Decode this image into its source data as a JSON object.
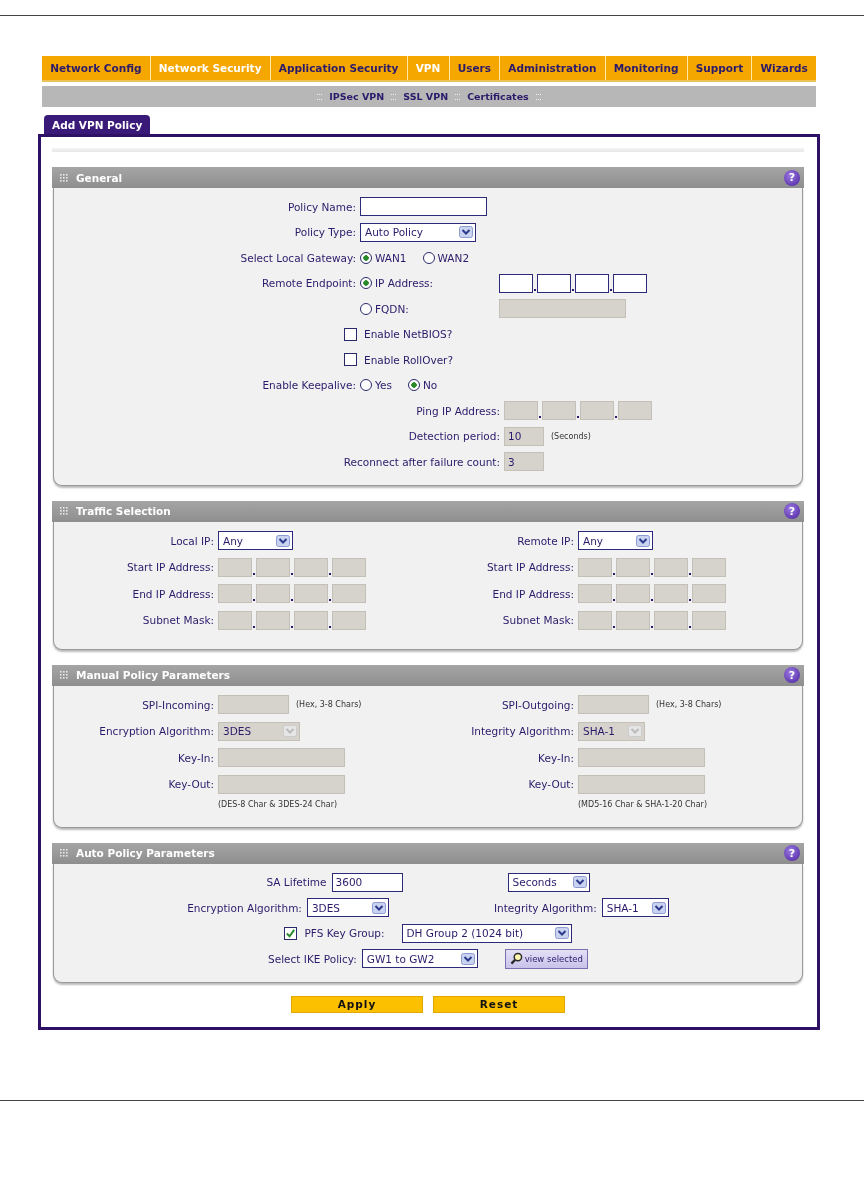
{
  "nav": [
    {
      "label": "Network Config",
      "selected": false
    },
    {
      "label": "Network Security",
      "selected": true
    },
    {
      "label": "Application Security",
      "selected": false
    },
    {
      "label": "VPN",
      "selected": true
    },
    {
      "label": "Users",
      "selected": false
    },
    {
      "label": "Administration",
      "selected": false
    },
    {
      "label": "Monitoring",
      "selected": false
    },
    {
      "label": "Support",
      "selected": false
    },
    {
      "label": "Wizards",
      "selected": false
    }
  ],
  "subnav": [
    {
      "label": "IPSec VPN"
    },
    {
      "label": "SSL VPN"
    },
    {
      "label": "Certificates"
    }
  ],
  "tabs": [
    {
      "label": "Add VPN Policy",
      "selected": true
    }
  ],
  "sections": [
    {
      "title": "General",
      "help": "?",
      "rows": [
        {
          "kind": "main",
          "label": "Policy Name:",
          "controls": [
            {
              "kind": "text",
              "disabled": false
            }
          ]
        },
        {
          "kind": "main",
          "label": "Policy Type:",
          "controls": [
            {
              "kind": "select",
              "value": "Auto Policy",
              "disabled": false
            }
          ]
        },
        {
          "kind": "main",
          "label": "Select Local Gateway:",
          "controls": [
            {
              "kind": "radio",
              "label": "WAN1",
              "selected": true
            },
            {
              "kind": "radio",
              "label": "WAN2",
              "selected": false
            }
          ]
        },
        {
          "kind": "main",
          "label": "Remote Endpoint:",
          "controls": [
            {
              "kind": "radio",
              "label": "IP Address:",
              "selected": true
            },
            {
              "kind": "ip",
              "disabled": false
            }
          ]
        },
        {
          "kind": "main",
          "controls": [
            {
              "kind": "radio",
              "label": "FQDN:",
              "selected": false
            },
            {
              "kind": "text",
              "disabled": true
            }
          ]
        },
        {
          "kind": "main",
          "controls": [
            {
              "kind": "checkbox",
              "label": "Enable NetBIOS?",
              "checked": false
            }
          ]
        },
        {
          "kind": "main",
          "controls": [
            {
              "kind": "checkbox",
              "label": "Enable RollOver?",
              "checked": false
            }
          ]
        },
        {
          "kind": "main",
          "label": "Enable Keepalive:",
          "controls": [
            {
              "kind": "radio",
              "label": "Yes",
              "selected": false
            },
            {
              "kind": "radio",
              "label": "No",
              "selected": true
            }
          ]
        },
        {
          "kind": "sub",
          "label": "Ping IP Address:",
          "controls": [
            {
              "kind": "ip",
              "disabled": true
            }
          ]
        },
        {
          "kind": "sub",
          "label": "Detection period:",
          "controls": [
            {
              "kind": "text",
              "value": "10",
              "disabled": true
            },
            {
              "kind": "note",
              "text": "(Seconds)"
            }
          ]
        },
        {
          "kind": "sub",
          "label": "Reconnect after failure count:",
          "controls": [
            {
              "kind": "text",
              "value": "3",
              "disabled": true
            }
          ]
        }
      ]
    },
    {
      "title": "Traffic Selection",
      "help": "?",
      "columns": [
        {
          "rows": [
            {
              "kind": "main",
              "label": "Local IP:",
              "controls": [
                {
                  "kind": "select",
                  "value": "Any",
                  "disabled": false
                }
              ]
            },
            {
              "kind": "main",
              "label": "Start IP Address:",
              "controls": [
                {
                  "kind": "ip",
                  "disabled": true
                }
              ]
            },
            {
              "kind": "main",
              "label": "End IP Address:",
              "controls": [
                {
                  "kind": "ip",
                  "disabled": true
                }
              ]
            },
            {
              "kind": "main",
              "label": "Subnet Mask:",
              "controls": [
                {
                  "kind": "ip",
                  "disabled": true
                }
              ]
            }
          ]
        },
        {
          "rows": [
            {
              "kind": "main",
              "label": "Remote IP:",
              "controls": [
                {
                  "kind": "select",
                  "value": "Any",
                  "disabled": false
                }
              ]
            },
            {
              "kind": "main",
              "label": "Start IP Address:",
              "controls": [
                {
                  "kind": "ip",
                  "disabled": true
                }
              ]
            },
            {
              "kind": "main",
              "label": "End IP Address:",
              "controls": [
                {
                  "kind": "ip",
                  "disabled": true
                }
              ]
            },
            {
              "kind": "main",
              "label": "Subnet Mask:",
              "controls": [
                {
                  "kind": "ip",
                  "disabled": true
                }
              ]
            }
          ]
        }
      ]
    },
    {
      "title": "Manual Policy Parameters",
      "help": "?",
      "columns": [
        {
          "rows": [
            {
              "kind": "main",
              "label": "SPI-Incoming:",
              "controls": [
                {
                  "kind": "text",
                  "disabled": true
                },
                {
                  "kind": "note",
                  "text": "(Hex, 3-8 Chars)"
                }
              ]
            },
            {
              "kind": "main",
              "label": "Encryption Algorithm:",
              "controls": [
                {
                  "kind": "select",
                  "value": "3DES",
                  "disabled": true
                }
              ]
            },
            {
              "kind": "main",
              "label": "Key-In:",
              "controls": [
                {
                  "kind": "text",
                  "disabled": true
                }
              ]
            },
            {
              "kind": "main",
              "label": "Key-Out:",
              "controls": [
                {
                  "kind": "text",
                  "disabled": true
                }
              ]
            },
            {
              "kind": "hint",
              "controls": [
                {
                  "kind": "note",
                  "text": "(DES-8 Char & 3DES-24 Char)"
                }
              ]
            }
          ]
        },
        {
          "rows": [
            {
              "kind": "main",
              "label": "SPI-Outgoing:",
              "controls": [
                {
                  "kind": "text",
                  "disabled": true
                },
                {
                  "kind": "note",
                  "text": "(Hex, 3-8 Chars)"
                }
              ]
            },
            {
              "kind": "main",
              "label": "Integrity Algorithm:",
              "controls": [
                {
                  "kind": "select",
                  "value": "SHA-1",
                  "disabled": true
                }
              ]
            },
            {
              "kind": "main",
              "label": "Key-In:",
              "controls": [
                {
                  "kind": "text",
                  "disabled": true
                }
              ]
            },
            {
              "kind": "main",
              "label": "Key-Out:",
              "controls": [
                {
                  "kind": "text",
                  "disabled": true
                }
              ]
            },
            {
              "kind": "hint",
              "controls": [
                {
                  "kind": "note",
                  "text": "(MD5-16 Char & SHA-1-20 Char)"
                }
              ]
            }
          ]
        }
      ]
    },
    {
      "title": "Auto Policy Parameters",
      "help": "?",
      "rows": [
        {
          "kind": "center",
          "label": "SA Lifetime",
          "controls": [
            {
              "kind": "text",
              "value": "3600",
              "disabled": false
            },
            {
              "kind": "select",
              "value": "Seconds",
              "disabled": false
            }
          ]
        },
        {
          "kind": "center",
          "label": "Encryption Algorithm:",
          "controls": [
            {
              "kind": "select",
              "value": "3DES",
              "disabled": false
            },
            {
              "kind": "label",
              "text": "Integrity Algorithm:"
            },
            {
              "kind": "select",
              "value": "SHA-1",
              "disabled": false
            }
          ]
        },
        {
          "kind": "center",
          "controls": [
            {
              "kind": "checkbox",
              "label": "PFS Key Group:",
              "checked": true
            },
            {
              "kind": "select",
              "value": "DH Group 2 (1024 bit)",
              "disabled": false
            }
          ]
        },
        {
          "kind": "center",
          "label": "Select IKE Policy:",
          "controls": [
            {
              "kind": "select",
              "value": "GW1 to GW2",
              "disabled": false
            },
            {
              "kind": "button",
              "label": "view selected"
            }
          ]
        }
      ]
    }
  ],
  "buttons": [
    {
      "label": "Apply"
    },
    {
      "label": "Reset"
    }
  ]
}
